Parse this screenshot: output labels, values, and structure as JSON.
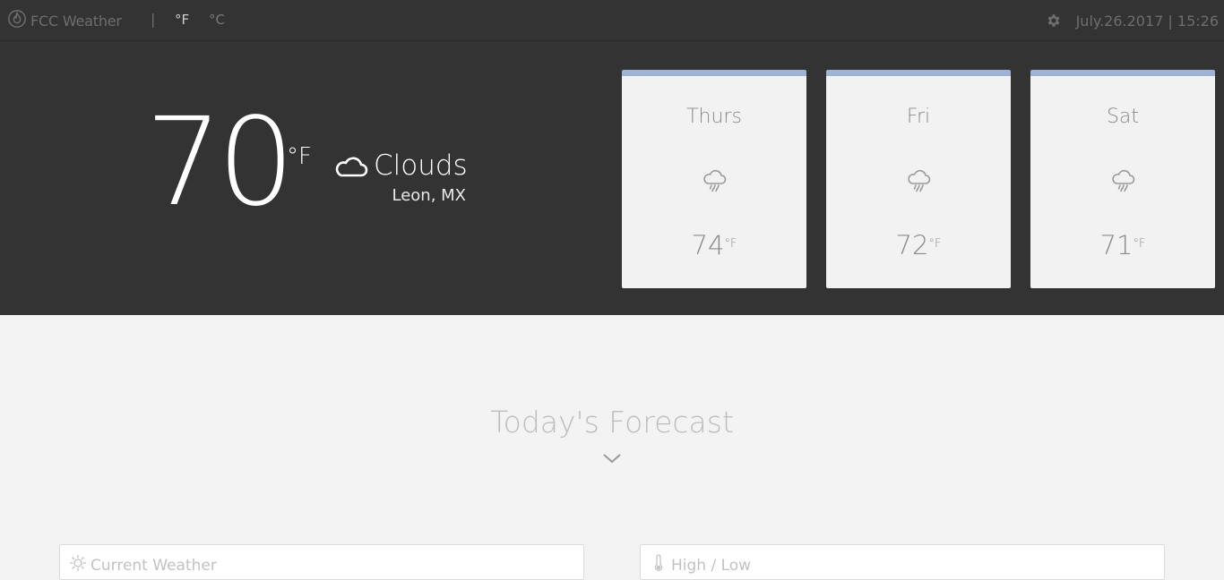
{
  "navbar": {
    "brand_label": "FCC Weather",
    "brand_icon": "fire-icon",
    "separator": "|",
    "unit_f": "°F",
    "unit_c": "°C",
    "settings_icon": "gear-icon",
    "datetime": "July.26.2017 | 15:26"
  },
  "current": {
    "temperature": "70",
    "unit": "°F",
    "condition": "Clouds",
    "condition_icon": "cloud-icon",
    "location": "Leon, MX"
  },
  "forecast": [
    {
      "day": "Thurs",
      "icon": "rain-cloud-icon",
      "temp": "74",
      "unit": "°F"
    },
    {
      "day": "Fri",
      "icon": "rain-cloud-icon",
      "temp": "72",
      "unit": "°F"
    },
    {
      "day": "Sat",
      "icon": "rain-cloud-icon",
      "temp": "71",
      "unit": "°F"
    }
  ],
  "section": {
    "title": "Today's Forecast",
    "expand_icon": "chevron-down-icon"
  },
  "panels": [
    {
      "title": "Current Weather",
      "icon": "sun-icon"
    },
    {
      "title": "High / Low",
      "icon": "thermometer-icon"
    }
  ],
  "colors": {
    "header_bg": "#333333",
    "body_bg": "#f3f3f3",
    "card_accent": "#9fb3d6",
    "card_bg": "#f2f2f2"
  }
}
